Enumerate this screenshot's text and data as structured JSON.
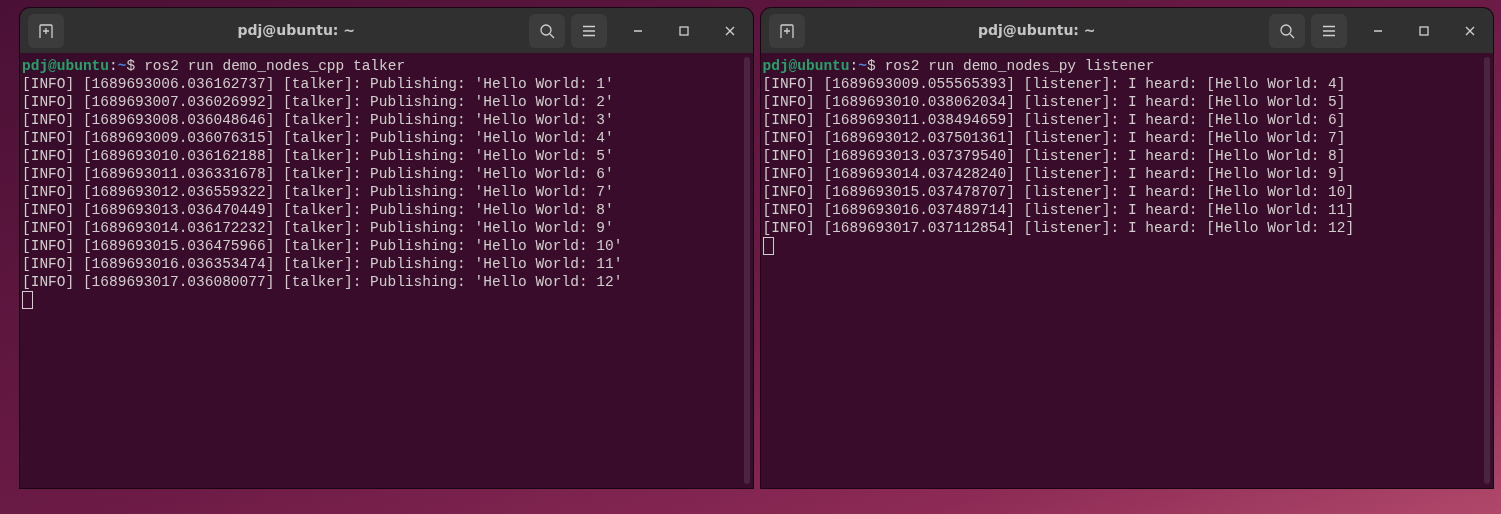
{
  "windows": [
    {
      "title": "pdj@ubuntu: ~",
      "prompt": {
        "user_host": "pdj@ubuntu",
        "separator": ":",
        "path": "~",
        "symbol": "$",
        "command": "ros2 run demo_nodes_cpp talker"
      },
      "lines": [
        "[INFO] [1689693006.036162737] [talker]: Publishing: 'Hello World: 1'",
        "[INFO] [1689693007.036026992] [talker]: Publishing: 'Hello World: 2'",
        "[INFO] [1689693008.036048646] [talker]: Publishing: 'Hello World: 3'",
        "[INFO] [1689693009.036076315] [talker]: Publishing: 'Hello World: 4'",
        "[INFO] [1689693010.036162188] [talker]: Publishing: 'Hello World: 5'",
        "[INFO] [1689693011.036331678] [talker]: Publishing: 'Hello World: 6'",
        "[INFO] [1689693012.036559322] [talker]: Publishing: 'Hello World: 7'",
        "[INFO] [1689693013.036470449] [talker]: Publishing: 'Hello World: 8'",
        "[INFO] [1689693014.036172232] [talker]: Publishing: 'Hello World: 9'",
        "[INFO] [1689693015.036475966] [talker]: Publishing: 'Hello World: 10'",
        "[INFO] [1689693016.036353474] [talker]: Publishing: 'Hello World: 11'",
        "[INFO] [1689693017.036080077] [talker]: Publishing: 'Hello World: 12'"
      ]
    },
    {
      "title": "pdj@ubuntu: ~",
      "prompt": {
        "user_host": "pdj@ubuntu",
        "separator": ":",
        "path": "~",
        "symbol": "$",
        "command": "ros2 run demo_nodes_py listener"
      },
      "lines": [
        "[INFO] [1689693009.055565393] [listener]: I heard: [Hello World: 4]",
        "[INFO] [1689693010.038062034] [listener]: I heard: [Hello World: 5]",
        "[INFO] [1689693011.038494659] [listener]: I heard: [Hello World: 6]",
        "[INFO] [1689693012.037501361] [listener]: I heard: [Hello World: 7]",
        "[INFO] [1689693013.037379540] [listener]: I heard: [Hello World: 8]",
        "[INFO] [1689693014.037428240] [listener]: I heard: [Hello World: 9]",
        "[INFO] [1689693015.037478707] [listener]: I heard: [Hello World: 10]",
        "[INFO] [1689693016.037489714] [listener]: I heard: [Hello World: 11]",
        "[INFO] [1689693017.037112854] [listener]: I heard: [Hello World: 12]"
      ]
    }
  ]
}
